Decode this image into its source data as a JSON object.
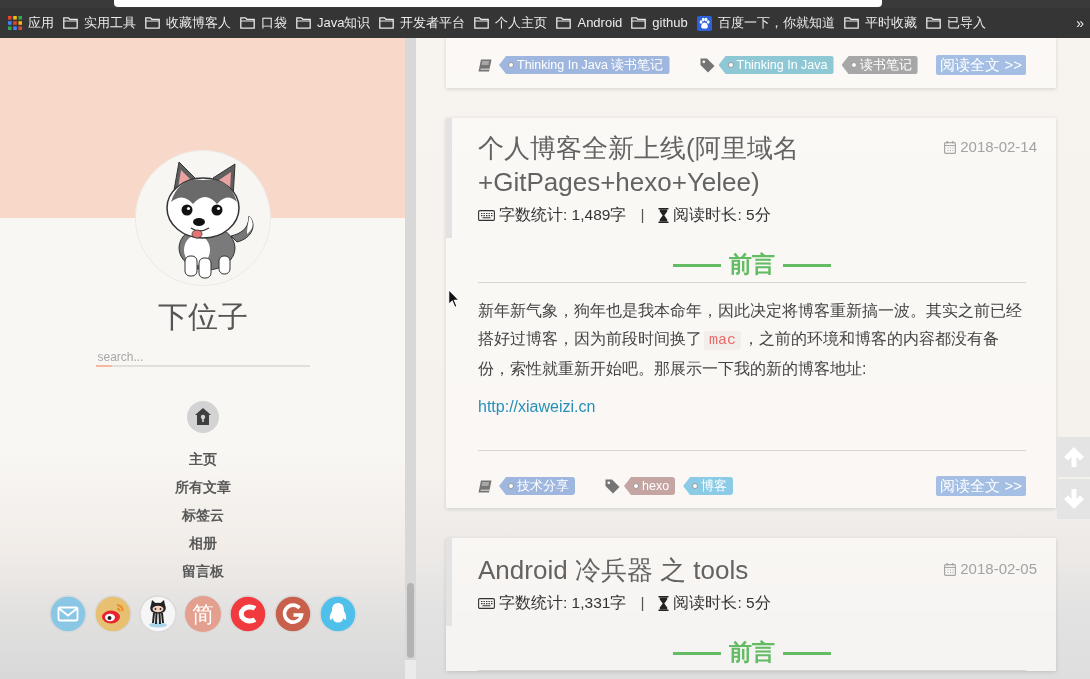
{
  "browser": {
    "bookmarks": [
      {
        "kind": "apps",
        "label": "应用"
      },
      {
        "kind": "folder",
        "label": "实用工具"
      },
      {
        "kind": "folder",
        "label": "收藏博客人"
      },
      {
        "kind": "folder",
        "label": "口袋"
      },
      {
        "kind": "folder",
        "label": "Java知识"
      },
      {
        "kind": "folder",
        "label": "开发者平台"
      },
      {
        "kind": "folder",
        "label": "个人主页"
      },
      {
        "kind": "folder",
        "label": "Android"
      },
      {
        "kind": "folder",
        "label": "github"
      },
      {
        "kind": "site",
        "label": "百度一下，你就知道"
      },
      {
        "kind": "folder",
        "label": "平时收藏"
      },
      {
        "kind": "folder",
        "label": "已导入"
      }
    ],
    "more": "»"
  },
  "sidebar": {
    "site_name": "下位子",
    "search": {
      "placeholder": "search..."
    },
    "nav": [
      {
        "label": "主页"
      },
      {
        "label": "所有文章"
      },
      {
        "label": "标签云"
      },
      {
        "label": "相册"
      },
      {
        "label": "留言板"
      }
    ],
    "social": [
      {
        "kind": "mail"
      },
      {
        "kind": "eye"
      },
      {
        "kind": "cat"
      },
      {
        "kind": "text",
        "label": "简"
      },
      {
        "kind": "c"
      },
      {
        "kind": "g"
      },
      {
        "kind": "penguin"
      }
    ]
  },
  "posts": [
    {
      "footer": {
        "categories": [
          {
            "label": "Thinking In Java 读书笔记",
            "color": "#9fb7df"
          }
        ],
        "tags": [
          {
            "label": "Thinking In Java",
            "color": "#8fc8d5"
          },
          {
            "label": "读书笔记",
            "color": "#a7a7a7"
          }
        ],
        "read_more": "阅读全文 >>"
      }
    },
    {
      "title": "个人博客全新上线(阿里域名+GitPages+hexo+Yelee)",
      "date": "2018-02-14",
      "word_count": "字数统计: 1,489字",
      "separator": "|",
      "read_time": "阅读时长: 5分",
      "heading": "前言",
      "body": [
        {
          "kind": "paragraph",
          "parts": [
            {
              "kind": "text",
              "text": "新年新气象，狗年也是我本命年，因此决定将博客重新搞一波。其实之前已经搭好过博客，因为前段时间换了"
            },
            {
              "kind": "code",
              "text": "mac"
            },
            {
              "kind": "text",
              "text": "，之前的环境和博客的内容都没有备份，索性就重新开始吧。那展示一下我的新的博客地址:"
            }
          ]
        },
        {
          "kind": "link",
          "text": "http://xiaweizi.cn"
        }
      ],
      "footer": {
        "categories": [
          {
            "label": "技术分享",
            "color": "#9fb7df"
          }
        ],
        "tags": [
          {
            "label": "hexo",
            "color": "#c4a5a1"
          },
          {
            "label": "博客",
            "color": "#8ccbe5"
          }
        ],
        "read_more": "阅读全文 >>"
      }
    },
    {
      "title": "Android 冷兵器 之 tools",
      "date": "2018-02-05",
      "word_count": "字数统计: 1,331字",
      "separator": "|",
      "read_time": "阅读时长: 5分",
      "heading": "前言"
    }
  ]
}
